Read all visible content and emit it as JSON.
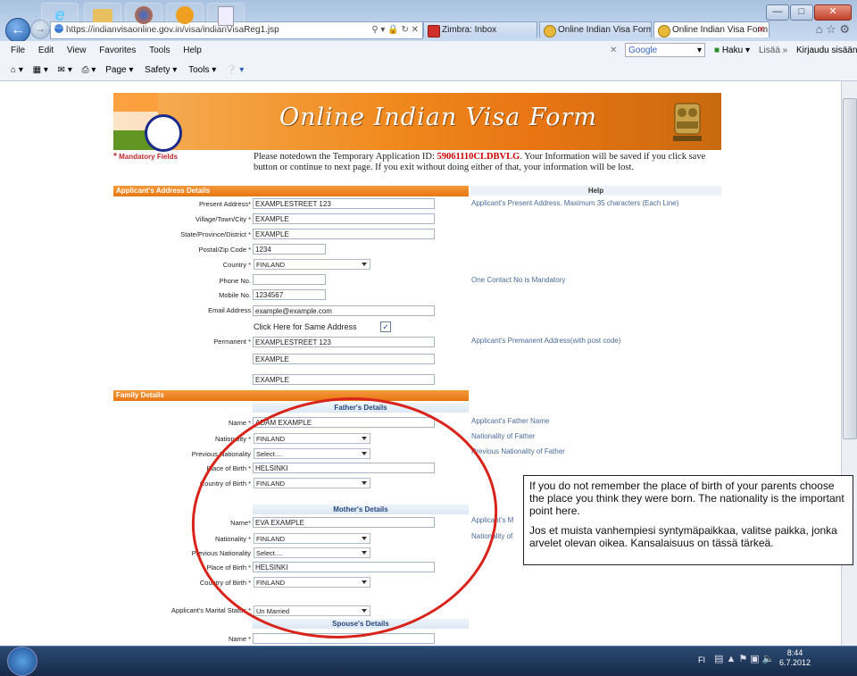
{
  "browser": {
    "url": "https://indianvisaonline.gov.in/visa/indianVisaReg1.jsp",
    "tabs": [
      {
        "label": "Zimbra: Inbox"
      },
      {
        "label": "Online Indian Visa Form"
      },
      {
        "label": "Online Indian Visa Form"
      }
    ],
    "menu": [
      "File",
      "Edit",
      "View",
      "Favorites",
      "Tools",
      "Help"
    ],
    "commands": [
      "Page ▾",
      "Safety ▾",
      "Tools ▾"
    ],
    "search_engine": "Google",
    "haku_label": "Haku ▾",
    "lisaa_label": "Lisää »",
    "kirjaudu_label": "Kirjaudu sisään"
  },
  "page": {
    "banner_title": "Online Indian Visa Form",
    "mandatory_label": "Mandatory Fields",
    "notice_before": "Please notedown the Temporary Application ID: ",
    "app_id": "59061110CLDBVLG",
    "notice_after": ". Your Information will be saved if you click save button or continue to next page. If you exit without doing either of that, your information will be lost.",
    "address_section": {
      "title": "Applicant's Address Details",
      "help_header": "Help",
      "present_address_label": "Present Address*",
      "present_address": "EXAMPLESTREET 123",
      "village_label": "Village/Town/City *",
      "village": "EXAMPLE",
      "state_label": "State/Province/District *",
      "state": "EXAMPLE",
      "postal_label": "Postal/Zip Code *",
      "postal": "1234",
      "country_label": "Country *",
      "country": "FINLAND",
      "phone_label": "Phone No.",
      "phone": "",
      "mobile_label": "Mobile No.",
      "mobile": "1234567",
      "email_label": "Email Address",
      "email": "example@example.com",
      "same_address_label": "Click Here for Same Address",
      "permanent_label": "Permanent *",
      "permanent_1": "EXAMPLESTREET 123",
      "permanent_2": "EXAMPLE",
      "permanent_3": "EXAMPLE",
      "help_present": "Applicant's Present Address. Maximum 35 characters (Each Line)",
      "help_contact": "One Contact No is Mandatory",
      "help_permanent": "Applicant's Premanent Address(with post code)"
    },
    "family_section": {
      "title": "Family Details",
      "father_header": "Father's Details",
      "father_name_label": "Name *",
      "father_name": "ADAM EXAMPLE",
      "father_nationality_label": "Nationality *",
      "father_nationality": "FINLAND",
      "father_prev_nat_label": "Previous Nationality",
      "father_prev_nat": "Select....",
      "father_pob_label": "Place of Birth *",
      "father_pob": "HELSINKI",
      "father_cob_label": "Country of Birth *",
      "father_cob": "FINLAND",
      "help_father_name": "Applicant's Father Name",
      "help_father_nat": "Nationality of Father",
      "help_father_prev": "Previous Nationality of Father",
      "mother_header": "Mother's Details",
      "mother_name_label": "Name*",
      "mother_name": "EVA EXAMPLE",
      "mother_nationality_label": "Nationality *",
      "mother_nationality": "FINLAND",
      "mother_prev_nat_label": "Previous Nationality",
      "mother_prev_nat": "Select....",
      "mother_pob_label": "Place of Birth *",
      "mother_pob": "HELSINKI",
      "mother_cob_label": "Country of Birth *",
      "mother_cob": "FINLAND",
      "help_mother_name": "Applicant's M",
      "help_mother_nat": "Nationality of",
      "marital_label": "Applicant's Marital Status *",
      "marital": "Un Married",
      "spouse_header": "Spouse's Details",
      "spouse_name_label": "Name *",
      "spouse_name": ""
    }
  },
  "annotation": {
    "english": "If you do not remember the place of birth of your parents choose the place you think they were born. The nationality is the important point here.",
    "finnish": "Jos et muista vanhempiesi syntymäpaikkaa, valitse paikka, jonka arvelet olevan oikea. Kansalaisuus on tässä tärkeä.",
    "circle_color": "#d9241c"
  },
  "taskbar": {
    "lang": "FI",
    "time": "8:44",
    "date": "6.7.2012"
  }
}
